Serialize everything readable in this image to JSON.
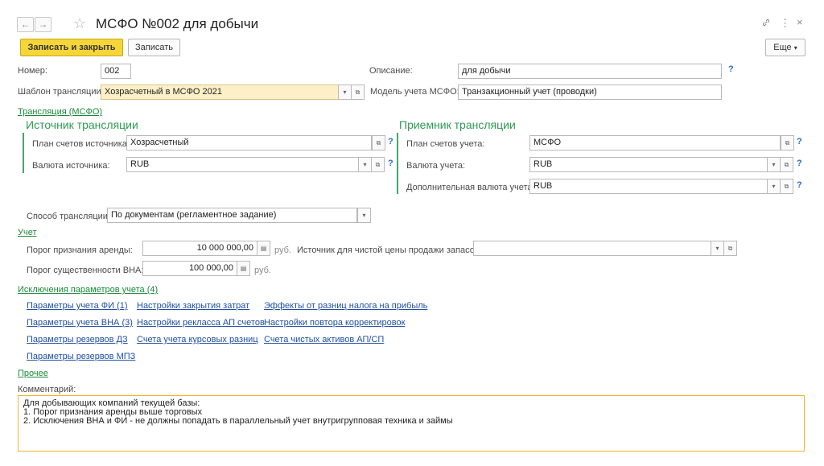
{
  "window": {
    "title": "МСФО №002 для добычи",
    "back_icon": "←",
    "forward_icon": "→",
    "star_icon": "☆",
    "link_icon": "🔗",
    "more_icon": "⋮",
    "close_icon": "×"
  },
  "toolbar": {
    "save_close_label": "Записать и закрыть",
    "save_label": "Записать",
    "more_label": "Еще",
    "more_arrow": "▾"
  },
  "header": {
    "number_label": "Номер:",
    "number_value": "002",
    "description_label": "Описание:",
    "description_value": "для добычи",
    "template_label": "Шаблон трансляции:",
    "template_value": "Хозрасчетный в МСФО 2021",
    "model_label": "Модель учета МСФО:",
    "model_value": "Транзакционный учет (проводки)"
  },
  "translation": {
    "link": "Трансляция (МСФО)",
    "source_title": "Источник трансляции",
    "source_chart_label": "План счетов источника:",
    "source_chart_value": "Хозрасчетный",
    "source_currency_label": "Валюта источника:",
    "source_currency_value": "RUB",
    "target_title": "Приемник трансляции",
    "target_chart_label": "План счетов учета:",
    "target_chart_value": "МСФО",
    "target_currency_label": "Валюта учета:",
    "target_currency_value": "RUB",
    "target_add_currency_label": "Дополнительная валюта учета:",
    "target_add_currency_value": "RUB",
    "method_label": "Способ трансляции:",
    "method_value": "По документам (регламентное задание)"
  },
  "accounting": {
    "link": "Учет",
    "lease_threshold_label": "Порог признания аренды:",
    "lease_threshold_value": "10 000 000,00",
    "materiality_label": "Порог существенности ВНА:",
    "materiality_value": "100 000,00",
    "unit": "руб.",
    "unit_dim": "руб.",
    "net_price_source_label": "Источник для чистой цены продажи запасов:",
    "net_price_source_value": ""
  },
  "exceptions": {
    "link": "Исключения параметров учета (4)",
    "col1": [
      "Параметры учета ФИ (1)",
      "Параметры учета ВНА (3)",
      "Параметры резервов ДЗ",
      "Параметры резервов МПЗ"
    ],
    "col2": [
      "Настройки закрытия затрат",
      "Настройки рекласса АП счетов",
      "Счета учета курсовых разниц"
    ],
    "col3": [
      "Эффекты от разниц налога на прибыль",
      "Настройки повтора корректировок",
      "Счета чистых активов АП/СП"
    ]
  },
  "other": {
    "link": "Прочее",
    "comment_label": "Комментарий:",
    "comment_line1": "Для добывающих компаний текущей базы:",
    "comment_line2": "1. Порог признания аренды выше торговых",
    "comment_line3": "2. Исключения ВНА и ФИ - не должны попадать в параллельный учет внутригрупповая техника и займы"
  },
  "icons": {
    "dropdown": "▾",
    "open": "⧉",
    "calc": "▤",
    "help": "?"
  },
  "colors": {
    "accent_green": "#2f9a55",
    "primary_button": "#f6d539",
    "link_blue": "#1f4fa3",
    "comment_border": "#f0b428"
  }
}
